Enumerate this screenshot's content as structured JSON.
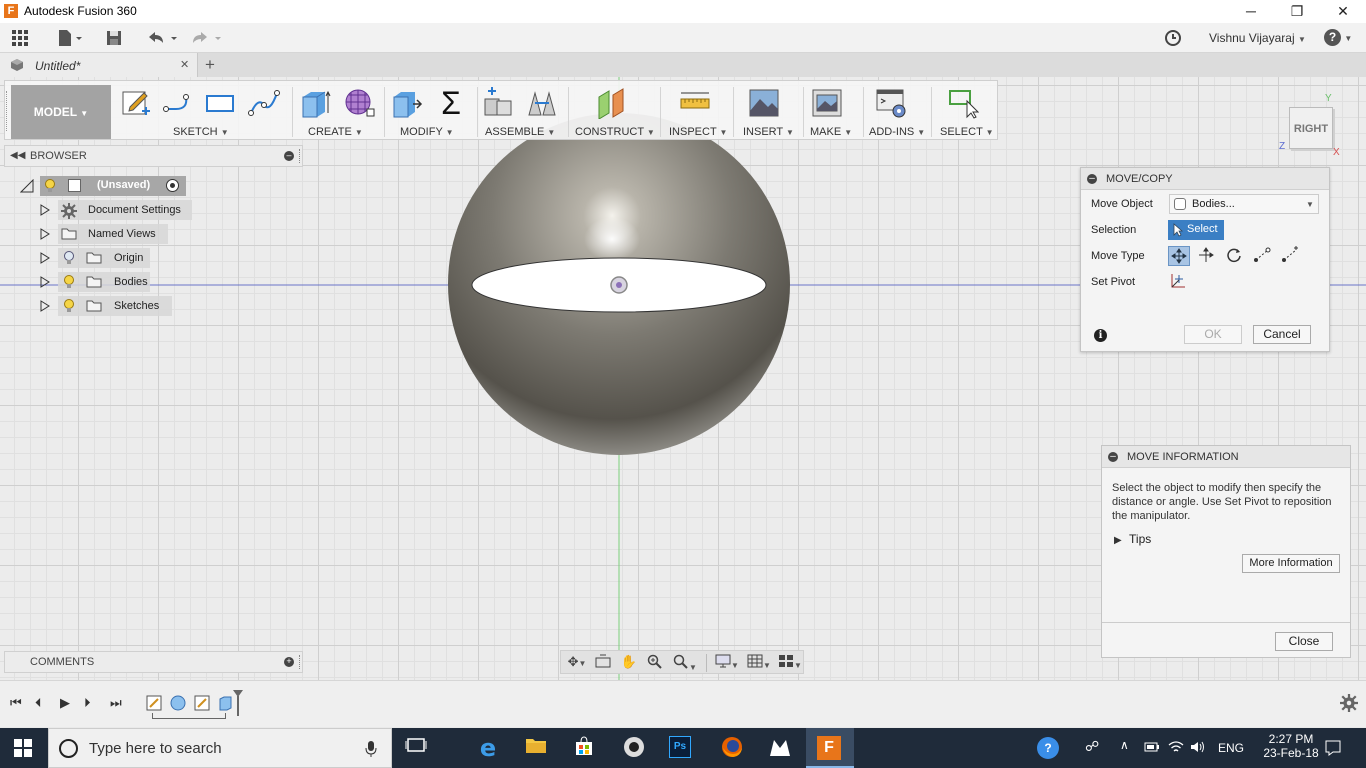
{
  "window": {
    "title": "Autodesk Fusion 360",
    "app_icon_letter": "F",
    "minimize": "─",
    "maximize": "❐",
    "close": "✕"
  },
  "app_toolbar": {
    "user_name": "Vishnu Vijayaraj",
    "help": "?"
  },
  "tab": {
    "label": "Untitled*",
    "close": "✕",
    "add": "+"
  },
  "ribbon": {
    "workspace": "MODEL",
    "groups": {
      "sketch": "SKETCH",
      "create": "CREATE",
      "modify": "MODIFY",
      "assemble": "ASSEMBLE",
      "construct": "CONSTRUCT",
      "inspect": "INSPECT",
      "insert": "INSERT",
      "make": "MAKE",
      "addins": "ADD-INS",
      "select": "SELECT"
    },
    "sigma": "Σ"
  },
  "browser": {
    "title": "BROWSER",
    "root": "(Unsaved)",
    "items": [
      {
        "label": "Document Settings"
      },
      {
        "label": "Named Views"
      },
      {
        "label": "Origin"
      },
      {
        "label": "Bodies"
      },
      {
        "label": "Sketches"
      }
    ]
  },
  "comments": {
    "title": "COMMENTS"
  },
  "viewcube": {
    "face": "RIGHT",
    "y": "Y",
    "z": "Z",
    "x": "X"
  },
  "move_copy": {
    "title": "MOVE/COPY",
    "move_object_label": "Move Object",
    "move_object_value": "Bodies...",
    "selection_label": "Selection",
    "selection_button": "Select",
    "move_type_label": "Move Type",
    "set_pivot_label": "Set Pivot",
    "ok": "OK",
    "cancel": "Cancel"
  },
  "move_info": {
    "title": "MOVE INFORMATION",
    "body": "Select the object to modify then specify the distance or angle. Use Set Pivot to reposition the manipulator.",
    "tips": "Tips",
    "more_info": "More Information",
    "close": "Close"
  },
  "taskbar": {
    "search_placeholder": "Type here to search",
    "lang": "ENG",
    "time": "2:27 PM",
    "date": "23-Feb-18"
  },
  "colors": {
    "accent_blue": "#3b7fc4",
    "model_button": "#a3a3a3",
    "taskbar": "#1f2b3a",
    "sphere": "#7d7a72"
  }
}
